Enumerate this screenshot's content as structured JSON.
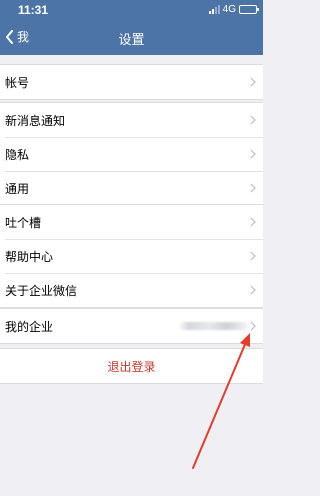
{
  "status_bar": {
    "time": "11:31",
    "network": "4G",
    "signal_level": 2,
    "battery_level": 1.0
  },
  "nav": {
    "back_label": "我",
    "title": "设置"
  },
  "groups": [
    [
      "帐号"
    ],
    [
      "新消息通知",
      "隐私",
      "通用"
    ],
    [
      "吐个槽",
      "帮助中心",
      "关于企业微信"
    ],
    [
      "我的企业"
    ]
  ],
  "logout_label": "退出登录",
  "colors": {
    "nav_background": "#4d74a7",
    "page_background": "#efeff4",
    "logout_text": "#c0392b",
    "annotation_arrow": "#e53c2e"
  },
  "icons": {
    "back": "chevron-left-icon",
    "row": "chevron-right-icon"
  }
}
